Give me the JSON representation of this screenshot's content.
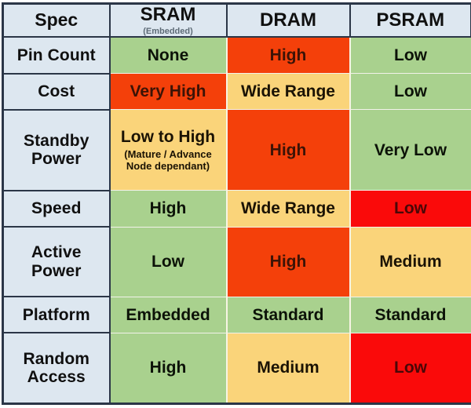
{
  "table": {
    "header": [
      {
        "main": "Spec",
        "sub": ""
      },
      {
        "main": "SRAM",
        "sub": "(Embedded)"
      },
      {
        "main": "DRAM",
        "sub": ""
      },
      {
        "main": "PSRAM",
        "sub": ""
      }
    ],
    "rows": [
      {
        "spec": "Pin Count",
        "cells": [
          {
            "main": "None",
            "sub": "",
            "color": "green"
          },
          {
            "main": "High",
            "sub": "",
            "color": "orange"
          },
          {
            "main": "Low",
            "sub": "",
            "color": "green"
          }
        ]
      },
      {
        "spec": "Cost",
        "cells": [
          {
            "main": "Very High",
            "sub": "",
            "color": "orange"
          },
          {
            "main": "Wide Range",
            "sub": "",
            "color": "yellow"
          },
          {
            "main": "Low",
            "sub": "",
            "color": "green"
          }
        ]
      },
      {
        "spec": "Standby Power",
        "cells": [
          {
            "main": "Low to High",
            "sub": "(Mature / Advance Node dependant)",
            "color": "yellow"
          },
          {
            "main": "High",
            "sub": "",
            "color": "orange"
          },
          {
            "main": "Very Low",
            "sub": "",
            "color": "green"
          }
        ]
      },
      {
        "spec": "Speed",
        "cells": [
          {
            "main": "High",
            "sub": "",
            "color": "green"
          },
          {
            "main": "Wide Range",
            "sub": "",
            "color": "yellow"
          },
          {
            "main": "Low",
            "sub": "",
            "color": "red"
          }
        ]
      },
      {
        "spec": "Active Power",
        "cells": [
          {
            "main": "Low",
            "sub": "",
            "color": "green"
          },
          {
            "main": "High",
            "sub": "",
            "color": "orange"
          },
          {
            "main": "Medium",
            "sub": "",
            "color": "yellow"
          }
        ]
      },
      {
        "spec": "Platform",
        "cells": [
          {
            "main": "Embedded",
            "sub": "",
            "color": "green"
          },
          {
            "main": "Standard",
            "sub": "",
            "color": "green"
          },
          {
            "main": "Standard",
            "sub": "",
            "color": "green"
          }
        ]
      },
      {
        "spec": "Random Access",
        "cells": [
          {
            "main": "High",
            "sub": "",
            "color": "green"
          },
          {
            "main": "Medium",
            "sub": "",
            "color": "yellow"
          },
          {
            "main": "Low",
            "sub": "",
            "color": "red"
          }
        ]
      }
    ],
    "colors": {
      "green": "#a9d18e",
      "yellow": "#fad47a",
      "orange": "#f4400a",
      "red": "#fa0a0a",
      "spec_background": "#dde7f0",
      "grid": "#2b3647"
    }
  }
}
